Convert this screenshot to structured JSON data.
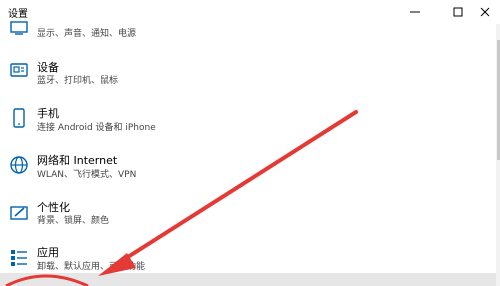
{
  "window": {
    "title": "设置",
    "minimize_icon": "minimize-icon",
    "maximize_icon": "maximize-icon",
    "close_icon": "close-icon"
  },
  "items": [
    {
      "label": "",
      "desc": "显示、声音、通知、电源",
      "icon": "display-icon"
    },
    {
      "label": "设备",
      "desc": "蓝牙、打印机、鼠标",
      "icon": "devices-icon"
    },
    {
      "label": "手机",
      "desc": "连接 Android 设备和 iPhone",
      "icon": "phone-icon"
    },
    {
      "label": "网络和 Internet",
      "desc": "WLAN、飞行模式、VPN",
      "icon": "globe-icon"
    },
    {
      "label": "个性化",
      "desc": "背景、锁屏、颜色",
      "icon": "personalization-icon"
    },
    {
      "label": "应用",
      "desc": "卸载、默认应用、可选功能",
      "icon": "apps-icon"
    }
  ],
  "colors": {
    "icon_blue": "#0063b1",
    "annotation_red": "#e53935"
  }
}
